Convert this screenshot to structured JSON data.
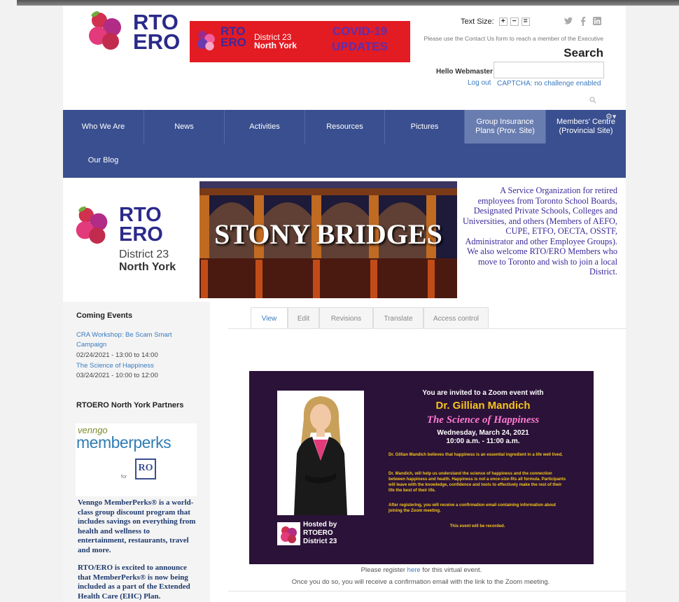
{
  "header": {
    "logo_line1": "RTO",
    "logo_line2": "ERO",
    "banner": {
      "logo_line1": "RTO",
      "logo_line2": "ERO",
      "district": "District 23",
      "area": "North York",
      "covid_line1": "COVID-19",
      "covid_line2": "UPDATES"
    },
    "text_size_label": "Text Size:",
    "text_size_buttons": [
      "+",
      "−",
      "="
    ],
    "social_icons": [
      "twitter-icon",
      "facebook-icon",
      "linkedin-icon"
    ],
    "contact_note": "Please use the Contact Us form to reach a member of the Executive",
    "search_title": "Search",
    "hello_label": "Hello Webmaster",
    "search_placeholder": "",
    "logout_label": "Log out",
    "captcha_label": "CAPTCHA: no challenge enabled"
  },
  "nav": {
    "items": [
      {
        "label": "Who We Are"
      },
      {
        "label": "News"
      },
      {
        "label": "Activities"
      },
      {
        "label": "Resources"
      },
      {
        "label": "Pictures"
      },
      {
        "label": "Group Insurance Plans (Prov. Site)"
      },
      {
        "label": "Members' Centre (Provincial Site)"
      },
      {
        "label": "Our Blog"
      }
    ]
  },
  "hero": {
    "logo_line1": "RTO",
    "logo_line2": "ERO",
    "district": "District 23",
    "area": "North York",
    "banner_title": "STONY BRIDGES",
    "mission": "A Service Organization for retired employees from Toronto School Boards, Designated Private Schools, Colleges and Universities, and others (Members of AEFO, CUPE, ETFO, OECTA, OSSTF, Administrator and other Employee Groups). We also welcome RTO/ERO Members who move to Toronto and wish to join a local District."
  },
  "sidebar": {
    "events_heading": "Coming Events",
    "events": [
      {
        "title": "CRA Workshop: Be Scam Smart Campaign",
        "date": "02/24/2021 - 13:00 to 14:00"
      },
      {
        "title": "The Science of Happiness",
        "date": "03/24/2021 - 10:00 to 12:00"
      }
    ],
    "partners_heading": "RTOERO North York Partners",
    "perks_vengo": "venngo",
    "perks_brand": "memberperks",
    "perks_for": "for",
    "perks_badge": "RO",
    "perks_desc": "Venngo MemberPerks® is a world-class group discount program that includes savings on everything from health and wellness to entertainment, restaurants, travel and more.",
    "perks_announce": "RTO/ERO is excited to announce that MemberPerks® is now being included as a part of the Extended Health Care (EHC) Plan."
  },
  "tabs": [
    "View",
    "Edit",
    "Revisions",
    "Translate",
    "Access control"
  ],
  "flyer": {
    "invite": "You are invited to a Zoom event with",
    "name": "Dr. Gillian Mandich",
    "topic": "The Science of Happiness",
    "date_line1": "Wednesday, March 24, 2021",
    "date_line2": "10:00 a.m. - 11:00 a.m.",
    "para1": "Dr. Gillian Mandich believes that happiness is an essential ingredient in a life well lived.",
    "para2": "Dr. Mandich, will help us understand the science of happiness and the connection between happiness and health. Happiness is not a once-size-fits all formula. Participants will leave with the knowledge, confidence and tools to effectively make the rest of their life the best of their life.",
    "para3": "After registering, you will receive a confirmation email containing information about joining the Zoom meeting.",
    "recorded": "This event will be recorded.",
    "hosted_by": "Hosted by",
    "hosted_org": "RTOERO",
    "hosted_district": "District 23"
  },
  "register": {
    "before": "Please register ",
    "link": "here",
    "after": " for this virtual event.",
    "confirm": "Once you do so, you will receive a confirmation email with the link to the Zoom meeting."
  },
  "colors": {
    "nav_bg": "#3a4f8f",
    "nav_active": "#6a7db0",
    "logo_text": "#2b2a8a",
    "link": "#3a7abf",
    "banner_red": "#e31b23",
    "flyer_bg": "#2b1238",
    "flyer_gold": "#f5c61b",
    "flyer_pink": "#ff7ad0"
  }
}
